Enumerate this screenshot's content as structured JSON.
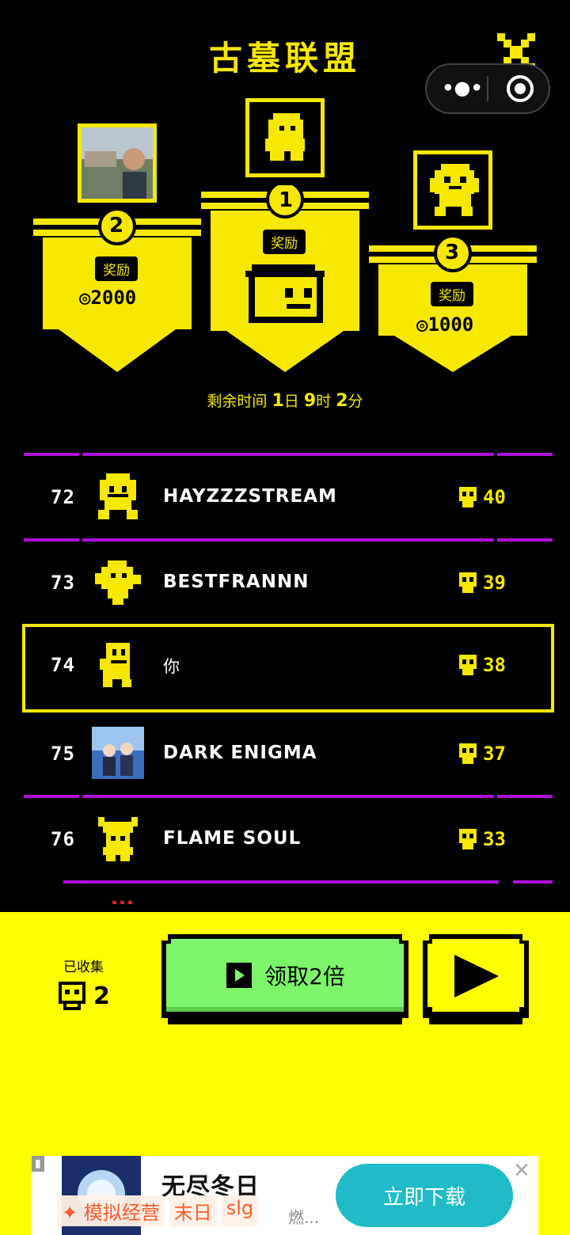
{
  "header": {
    "title": "古墓联盟"
  },
  "podium": [
    {
      "rank": "2",
      "reward_label": "奖励",
      "reward_amount": "◎2000"
    },
    {
      "rank": "1",
      "reward_label": "奖励"
    },
    {
      "rank": "3",
      "reward_label": "奖励",
      "reward_amount": "◎1000"
    }
  ],
  "timer": {
    "prefix": "剩余时间",
    "days": "1",
    "days_unit": "日",
    "hours": "9",
    "hours_unit": "时",
    "minutes": "2",
    "minutes_unit": "分"
  },
  "leaderboard": [
    {
      "rank": "72",
      "name": "HAYZZZSTREAM",
      "score": "40"
    },
    {
      "rank": "73",
      "name": "BESTFRANNN",
      "score": "39"
    },
    {
      "rank": "74",
      "name": "你",
      "score": "38"
    },
    {
      "rank": "75",
      "name": "DARK ENIGMA",
      "score": "37"
    },
    {
      "rank": "76",
      "name": "FLAME SOUL",
      "score": "33"
    }
  ],
  "footer": {
    "collected_label": "已收集",
    "collected_count": "2",
    "double_button_label": "领取2倍"
  },
  "ad": {
    "title": "无尽冬日",
    "subtitle": "燃...",
    "tags": [
      "模拟经营",
      "末日",
      "slg"
    ],
    "download_label": "立即下载"
  },
  "colors": {
    "accent": "#f6e800",
    "divider": "#b010d8",
    "button_green": "#7cf56a",
    "ad_button": "#1fbcc8"
  }
}
